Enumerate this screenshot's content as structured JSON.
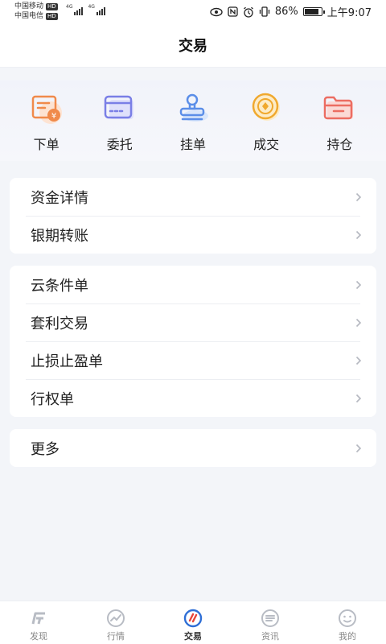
{
  "status_bar": {
    "carrier1": "中国移动",
    "carrier2": "中国电信",
    "hd": "HD",
    "net1": "4G",
    "net2": "4G",
    "battery": "86%",
    "time": "上午9:07"
  },
  "header": {
    "title": "交易"
  },
  "quick_actions": [
    {
      "label": "下单",
      "icon": "order-icon"
    },
    {
      "label": "委托",
      "icon": "entrust-icon"
    },
    {
      "label": "挂单",
      "icon": "pending-order-icon"
    },
    {
      "label": "成交",
      "icon": "deal-icon"
    },
    {
      "label": "持仓",
      "icon": "position-folder-icon"
    }
  ],
  "card1": [
    {
      "label": "资金详情"
    },
    {
      "label": "银期转账"
    }
  ],
  "card2": [
    {
      "label": "云条件单"
    },
    {
      "label": "套利交易"
    },
    {
      "label": "止损止盈单"
    },
    {
      "label": "行权单"
    }
  ],
  "card3": [
    {
      "label": "更多"
    }
  ],
  "bottom_nav": [
    {
      "label": "发现",
      "icon": "discover-icon",
      "active": false
    },
    {
      "label": "行情",
      "icon": "market-icon",
      "active": false
    },
    {
      "label": "交易",
      "icon": "trade-icon",
      "active": true
    },
    {
      "label": "资讯",
      "icon": "news-icon",
      "active": false
    },
    {
      "label": "我的",
      "icon": "profile-icon",
      "active": false
    }
  ],
  "colors": {
    "accent": "#e8443a",
    "nav_active": "#2f6fd6",
    "order": "#f08a4b",
    "entrust": "#7a7fe6",
    "pending": "#5b8ee8",
    "deal": "#f0a92e",
    "position": "#ec6d62"
  }
}
